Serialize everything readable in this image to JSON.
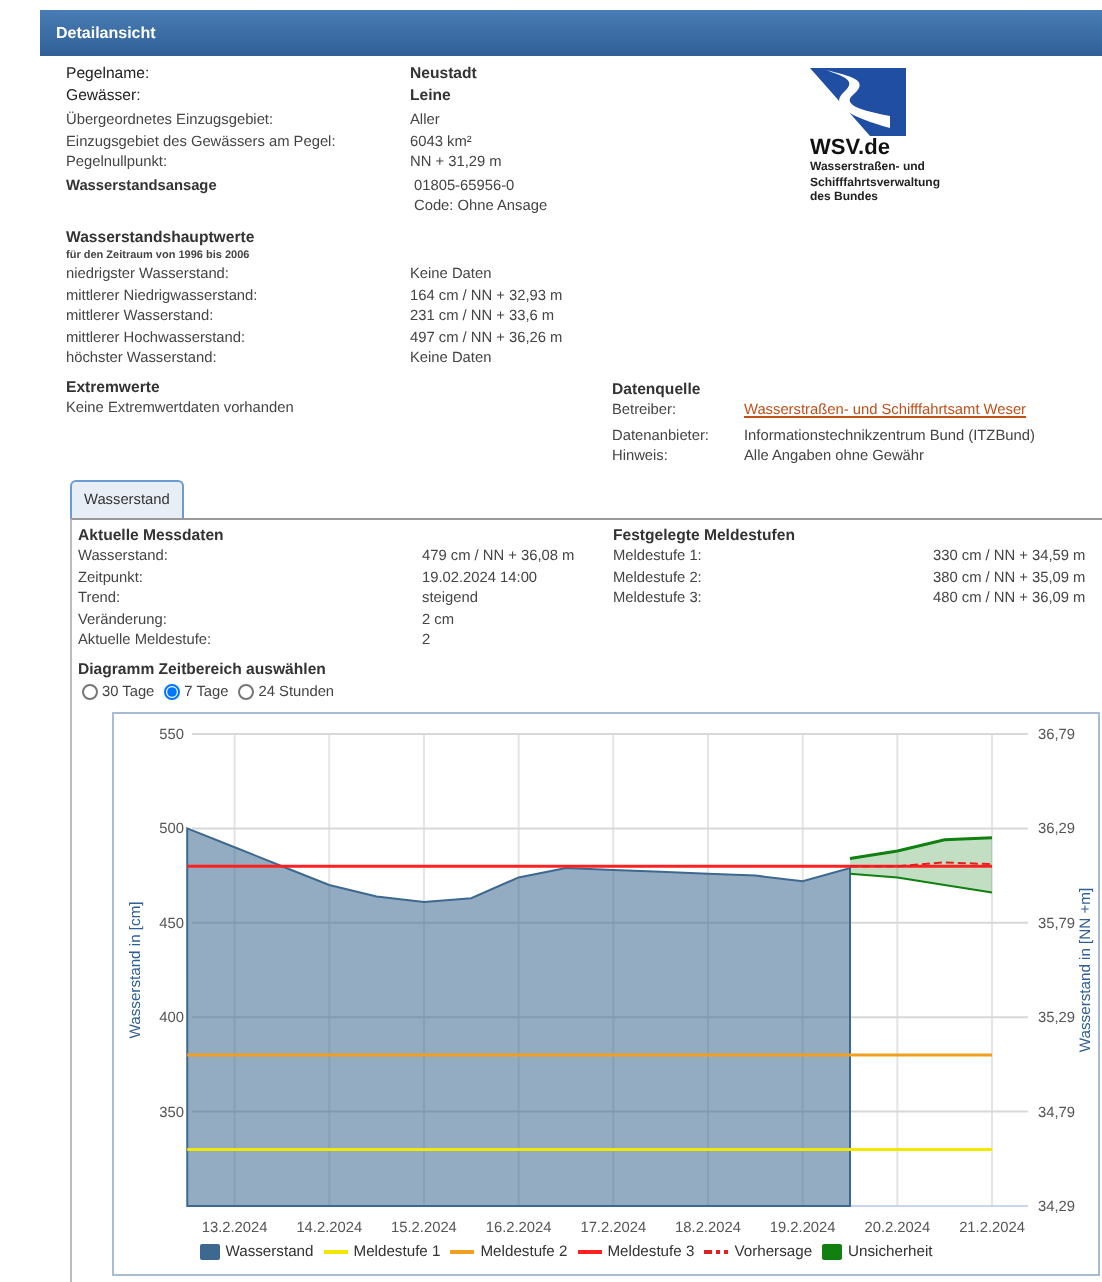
{
  "header": {
    "title": "Detailansicht"
  },
  "gauge": {
    "rows": [
      {
        "label": "Pegelname:",
        "values": [
          "Neustadt"
        ],
        "kind": "main"
      },
      {
        "label": "Gewässer:",
        "values": [
          "Leine"
        ],
        "kind": "main"
      },
      {
        "label": "Übergeordnetes Einzugsgebiet:",
        "values": [
          "Aller"
        ],
        "kind": "plain"
      },
      {
        "label": "Einzugsgebiet des Gewässers am Pegel:",
        "values": [
          "6043 km²"
        ],
        "kind": "plain"
      },
      {
        "label": "Pegelnullpunkt:",
        "values": [
          "NN + 31,29 m"
        ],
        "kind": "plain"
      },
      {
        "label": "Wasserstandsansage",
        "values": [
          "01805-65956-0",
          "Code: Ohne Ansage"
        ],
        "kind": "heading"
      }
    ]
  },
  "logo": {
    "title": "WSV.de",
    "lines": [
      "Wasserstraßen- und",
      "Schifffahrtsverwaltung",
      "des Bundes"
    ]
  },
  "hauptwerte": {
    "title": "Wasserstandshauptwerte",
    "subtitle": "für den Zeitraum von 1996 bis 2006",
    "rows": [
      {
        "label": "niedrigster Wasserstand:",
        "value": "Keine Daten"
      },
      {
        "label": "mittlerer Niedrigwasserstand:",
        "value": "164 cm / NN + 32,93 m"
      },
      {
        "label": "mittlerer Wasserstand:",
        "value": "231 cm / NN + 33,6 m"
      },
      {
        "label": "mittlerer Hochwasserstand:",
        "value": "497 cm / NN + 36,26 m"
      },
      {
        "label": "höchster Wasserstand:",
        "value": "Keine Daten"
      }
    ]
  },
  "extremwerte": {
    "title": "Extremwerte",
    "text": "Keine Extremwertdaten vorhanden"
  },
  "datenquelle": {
    "title": "Datenquelle",
    "rows": [
      {
        "label": "Betreiber:",
        "value": "Wasserstraßen- und Schifffahrtsamt Weser",
        "kind": "link"
      },
      {
        "label": "Datenanbieter:",
        "value": "Informationstechnikzentrum Bund (ITZBund)",
        "kind": "text"
      },
      {
        "label": "Hinweis:",
        "value": "Alle Angaben ohne Gewähr",
        "kind": "text"
      }
    ]
  },
  "tabs": [
    {
      "label": "Wasserstand",
      "selected": true
    }
  ],
  "messdaten": {
    "title": "Aktuelle Messdaten",
    "rows": [
      {
        "label": "Wasserstand:",
        "value": "479 cm / NN + 36,08 m"
      },
      {
        "label": "Zeitpunkt:",
        "value": "19.02.2024 14:00"
      },
      {
        "label": "Trend:",
        "value": "steigend"
      },
      {
        "label": "Veränderung:",
        "value": "2 cm"
      },
      {
        "label": "Aktuelle Meldestufe:",
        "value": "2"
      }
    ]
  },
  "meldestufen": {
    "title": "Festgelegte Meldestufen",
    "rows": [
      {
        "label": "Meldestufe 1:",
        "value": "330 cm / NN + 34,59 m"
      },
      {
        "label": "Meldestufe 2:",
        "value": "380 cm / NN + 35,09 m"
      },
      {
        "label": "Meldestufe 3:",
        "value": "480 cm / NN + 36,09 m"
      }
    ]
  },
  "zeitbereich": {
    "title": "Diagramm Zeitbereich auswählen",
    "options": [
      {
        "label": "30 Tage",
        "selected": false
      },
      {
        "label": "7 Tage",
        "selected": true
      },
      {
        "label": "24 Stunden",
        "selected": false
      }
    ]
  },
  "chart": {
    "right_ylabel": "Wasserstand in [NN +m]",
    "right_tick_labels": [
      "36,79",
      "36,29",
      "35,79",
      "35,29",
      "34,79",
      "34,29"
    ],
    "chart_data": {
      "type": "area",
      "ylabel": "Wasserstand in [cm]",
      "categories": [
        null,
        "13.2.2024",
        null,
        "14.2.2024",
        null,
        "15.2.2024",
        null,
        "16.2.2024",
        null,
        "17.2.2024",
        null,
        "18.2.2024",
        null,
        "19.2.2024",
        null,
        "20.2.2024",
        null,
        "21.2.2024"
      ],
      "ylim": [
        300,
        550
      ],
      "yticks": [
        350,
        400,
        450,
        500,
        550
      ],
      "grid": true,
      "legend": true,
      "series": [
        {
          "name": "Wasserstand",
          "color": "#3d6890",
          "values": [
            500,
            490,
            480,
            470,
            464,
            461,
            463,
            474,
            479,
            478,
            477,
            476,
            475,
            472,
            479,
            null,
            null,
            null
          ]
        },
        {
          "name": "Meldestufe 1",
          "type": "line",
          "color": "#f0e800",
          "values": [
            330,
            330,
            330,
            330,
            330,
            330,
            330,
            330,
            330,
            330,
            330,
            330,
            330,
            330,
            330,
            330,
            330,
            330
          ]
        },
        {
          "name": "Meldestufe 2",
          "type": "line",
          "color": "#f0a020",
          "values": [
            380,
            380,
            380,
            380,
            380,
            380,
            380,
            380,
            380,
            380,
            380,
            380,
            380,
            380,
            380,
            380,
            380,
            380
          ]
        },
        {
          "name": "Meldestufe 3",
          "type": "line",
          "color": "#ff2020",
          "values": [
            480,
            480,
            480,
            480,
            480,
            480,
            480,
            480,
            480,
            480,
            480,
            480,
            480,
            480,
            480,
            480,
            480,
            480
          ]
        },
        {
          "name": "Vorhersage",
          "type": "line",
          "line_style": "dashed",
          "color": "#e02020",
          "values": [
            null,
            null,
            null,
            null,
            null,
            null,
            null,
            null,
            null,
            null,
            null,
            null,
            null,
            null,
            480,
            480,
            482,
            481
          ]
        },
        {
          "name": "Unsicherheit",
          "type": "area",
          "color": "#108010",
          "values": [
            null,
            null,
            null,
            null,
            null,
            null,
            null,
            null,
            null,
            null,
            null,
            null,
            null,
            null,
            484,
            488,
            494,
            495
          ]
        },
        {
          "type": "line",
          "color": "#108010",
          "values": [
            null,
            null,
            null,
            null,
            null,
            null,
            null,
            null,
            null,
            null,
            null,
            null,
            null,
            null,
            476,
            474,
            470,
            466
          ]
        }
      ]
    }
  }
}
